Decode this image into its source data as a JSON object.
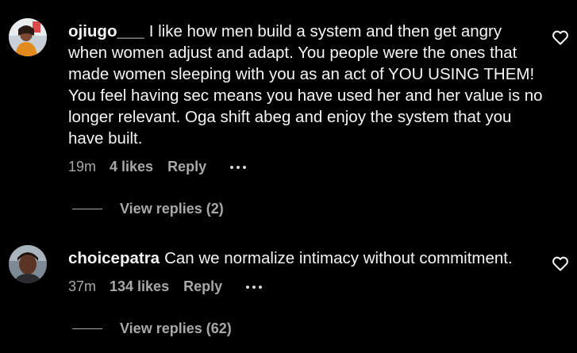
{
  "comments": [
    {
      "username": "ojiugo___",
      "text": "I like how men build a system and then get angry when women adjust and adapt. You people were the ones that made women sleeping with you as an act of YOU USING THEM! You feel having sec means you have used her and her value is no longer relevant. Oga shift abeg and enjoy the system that you have built.",
      "time": "19m",
      "likes": "4 likes",
      "reply_label": "Reply",
      "view_replies": "View replies (2)"
    },
    {
      "username": "choicepatra",
      "text": "Can we normalize intimacy without commitment.",
      "time": "37m",
      "likes": "134 likes",
      "reply_label": "Reply",
      "view_replies": "View replies (62)"
    }
  ],
  "icons": {
    "like": "heart-outline-icon",
    "more": "more-options-icon"
  },
  "colors": {
    "background": "#000000",
    "primary_text": "#f5f5f5",
    "secondary_text": "#a8a8a8"
  }
}
